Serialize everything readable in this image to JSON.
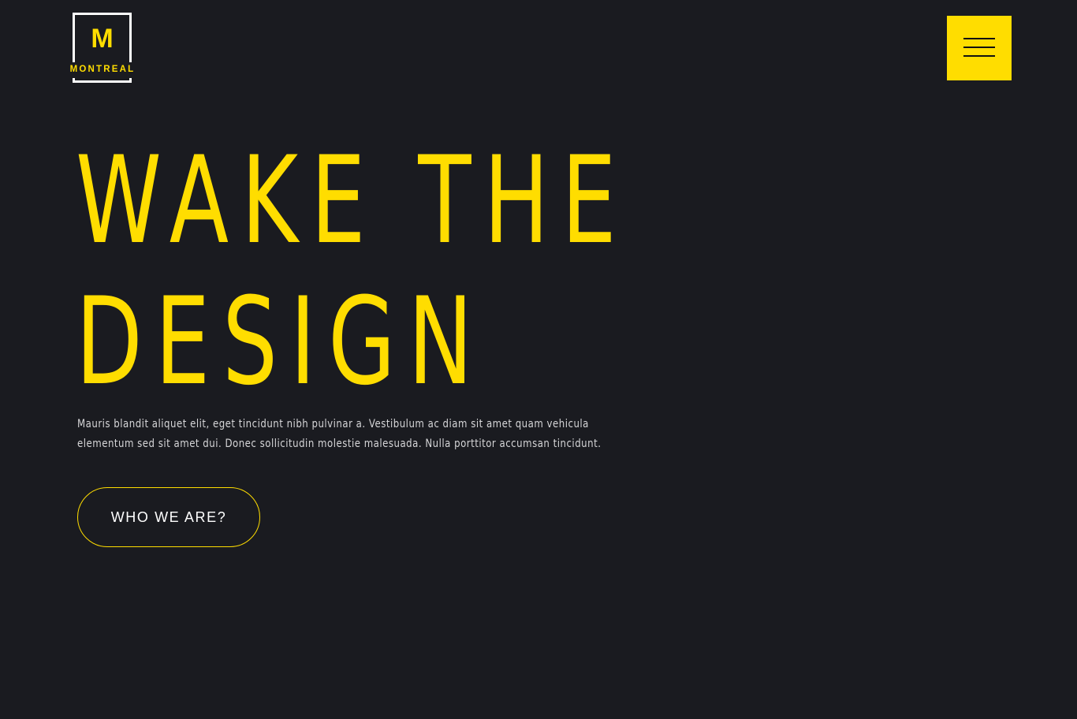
{
  "colors": {
    "background": "#1a1b20",
    "accent": "#ffdd00",
    "text": "#d6d6d8",
    "button_text": "#ffffff",
    "logo_frame": "#ffffff"
  },
  "header": {
    "logo": {
      "letter": "M",
      "wordmark": "MONTREAL"
    },
    "menu_button": {
      "icon": "hamburger-menu-icon"
    }
  },
  "hero": {
    "title_line_1": "WAKE THE",
    "title_line_2": "DESIGN",
    "description": "Mauris blandit aliquet elit, eget tincidunt nibh pulvinar a. Vestibulum ac diam sit amet quam vehicula elementum sed sit amet dui. Donec sollicitudin molestie malesuada. Nulla porttitor accumsan tincidunt.",
    "cta_label": "WHO WE ARE?"
  }
}
